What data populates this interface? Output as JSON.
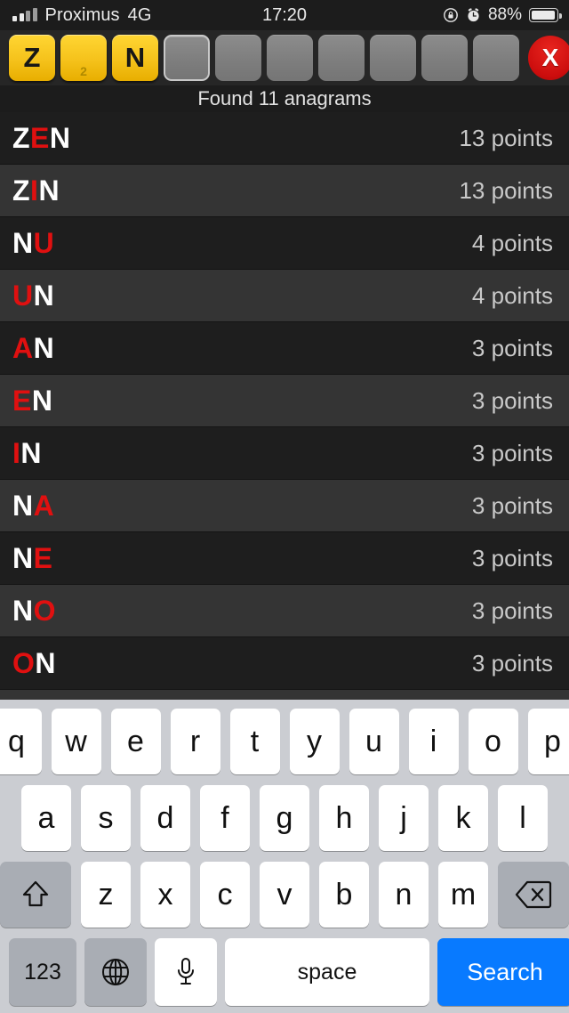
{
  "status_bar": {
    "carrier": "Proximus",
    "network": "4G",
    "time": "17:20",
    "battery_percent": "88%",
    "signal_bars_filled": 2,
    "signal_bars_total": 4,
    "icons": [
      "signal-bars-icon",
      "rotation-lock-icon",
      "alarm-clock-icon",
      "battery-icon"
    ]
  },
  "rack": {
    "tiles": [
      {
        "letter": "Z",
        "state": "filled",
        "subnum": ""
      },
      {
        "letter": "",
        "state": "filled",
        "subnum": "2"
      },
      {
        "letter": "N",
        "state": "filled",
        "subnum": ""
      },
      {
        "letter": "",
        "state": "empty-active",
        "subnum": ""
      },
      {
        "letter": "",
        "state": "empty",
        "subnum": ""
      },
      {
        "letter": "",
        "state": "empty",
        "subnum": ""
      },
      {
        "letter": "",
        "state": "empty",
        "subnum": ""
      },
      {
        "letter": "",
        "state": "empty",
        "subnum": ""
      },
      {
        "letter": "",
        "state": "empty",
        "subnum": ""
      },
      {
        "letter": "",
        "state": "empty",
        "subnum": ""
      }
    ],
    "clear_label": "X"
  },
  "found_bar": {
    "text": "Found 11 anagrams"
  },
  "results": {
    "count": 11,
    "rows": [
      {
        "prefix": "Z",
        "wild": "E",
        "suffix": "N",
        "points": "13 points"
      },
      {
        "prefix": "Z",
        "wild": "I",
        "suffix": "N",
        "points": "13 points"
      },
      {
        "prefix": "N",
        "wild": "U",
        "suffix": "",
        "points": "4 points"
      },
      {
        "prefix": "",
        "wild": "U",
        "suffix": "N",
        "points": "4 points"
      },
      {
        "prefix": "",
        "wild": "A",
        "suffix": "N",
        "points": "3 points"
      },
      {
        "prefix": "",
        "wild": "E",
        "suffix": "N",
        "points": "3 points"
      },
      {
        "prefix": "",
        "wild": "I",
        "suffix": "N",
        "points": "3 points"
      },
      {
        "prefix": "N",
        "wild": "A",
        "suffix": "",
        "points": "3 points"
      },
      {
        "prefix": "N",
        "wild": "E",
        "suffix": "",
        "points": "3 points"
      },
      {
        "prefix": "N",
        "wild": "O",
        "suffix": "",
        "points": "3 points"
      },
      {
        "prefix": "",
        "wild": "O",
        "suffix": "N",
        "points": "3 points"
      }
    ]
  },
  "keyboard": {
    "row1": [
      "q",
      "w",
      "e",
      "r",
      "t",
      "y",
      "u",
      "i",
      "o",
      "p"
    ],
    "row2": [
      "a",
      "s",
      "d",
      "f",
      "g",
      "h",
      "j",
      "k",
      "l"
    ],
    "row3": [
      "z",
      "x",
      "c",
      "v",
      "b",
      "n",
      "m"
    ],
    "shift_label": "shift-key",
    "delete_label": "delete-key",
    "numbers_label": "123",
    "globe_label": "globe-key",
    "mic_label": "mic-key",
    "space_label": "space",
    "search_label": "Search"
  },
  "colors": {
    "tile_yellow": "#f5c21b",
    "clear_red": "#cc0d0d",
    "wildcard_red": "#e01010",
    "row_dark": "#1e1e1e",
    "row_light": "#343434",
    "keyboard_bg": "#cbcdd2",
    "search_blue": "#087aff"
  }
}
